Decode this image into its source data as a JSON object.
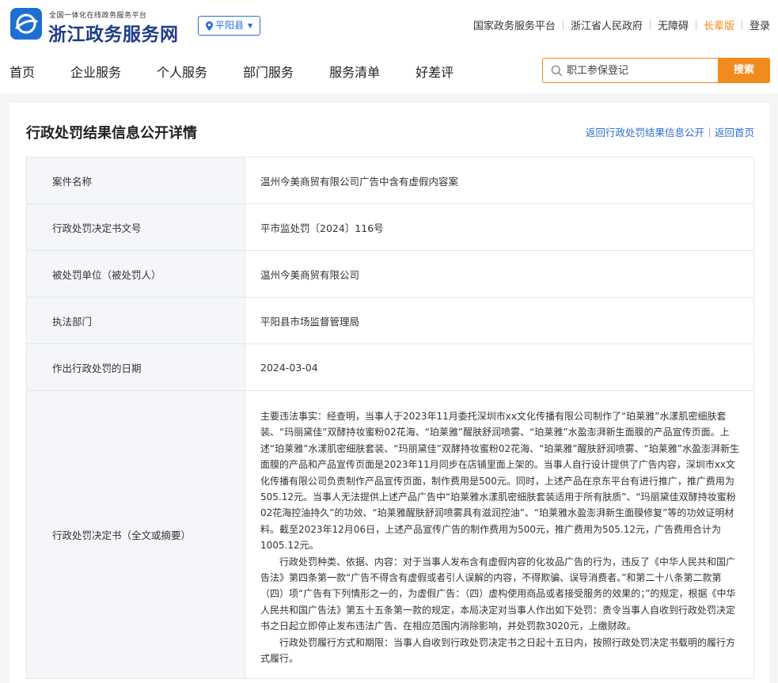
{
  "header": {
    "logo_subtitle": "全国一体化在线政务服务平台",
    "logo_title": "浙江政务服务网",
    "region": "平阳县",
    "top_links": [
      {
        "label": "国家政务服务平台"
      },
      {
        "label": "浙江省人民政府"
      },
      {
        "label": "无障碍"
      },
      {
        "label": "长辈版"
      },
      {
        "label": "登录"
      }
    ]
  },
  "nav": {
    "items": [
      {
        "label": "首页"
      },
      {
        "label": "企业服务"
      },
      {
        "label": "个人服务"
      },
      {
        "label": "部门服务"
      },
      {
        "label": "服务清单"
      },
      {
        "label": "好差评"
      }
    ]
  },
  "search": {
    "placeholder": "职工参保登记",
    "button": "搜索"
  },
  "page": {
    "title": "行政处罚结果信息公开详情",
    "back_link": "返回行政处罚结果信息公开",
    "home_link": "返回首页"
  },
  "rows": [
    {
      "key": "案件名称",
      "value": "温州今美商贸有限公司广告中含有虚假内容案"
    },
    {
      "key": "行政处罚决定书文号",
      "value": "平市监处罚〔2024〕116号"
    },
    {
      "key": "被处罚单位（被处罚人）",
      "value": "温州今美商贸有限公司"
    },
    {
      "key": "执法部门",
      "value": "平阳县市场监督管理局"
    },
    {
      "key": "作出行政处罚的日期",
      "value": "2024-03-04"
    }
  ],
  "decision": {
    "key": "行政处罚决定书（全文或摘要）",
    "paragraphs": [
      "主要违法事实：经查明，当事人于2023年11月委托深圳市xx文化传播有限公司制作了“珀莱雅”水漾肌密细肤套装、“玛丽黛佳”双酵持妆蜜粉02花海、“珀莱雅”醒肤舒润喷雾、“珀莱雅”水盈澎湃新生面膜的产品宣传页面。上述“珀莱雅”水漾肌密细肤套装、“玛丽黛佳”双酵持妆蜜粉02花海、“珀莱雅”醒肤舒润喷雾、“珀莱雅”水盈澎湃新生面膜的产品和产品宣传页面是2023年11月同步在店铺里面上架的。当事人自行设计提供了广告内容，深圳市xx文化传播有限公司负责制作产品宣传页面，制作费用是500元。同时，上述产品在京东平台有进行推广，推广费用为505.12元。当事人无法提供上述产品广告中“珀莱雅水漾肌密细肤套装适用于所有肤质”、“玛丽黛佳双酵持妆蜜粉02花海控油持久”的功效、“珀莱雅醒肤舒润喷雾具有滋润控油”、“珀莱雅水盈澎湃新生面膜修复”等的功效证明材料。截至2023年12月06日，上述产品宣传广告的制作费用为500元，推广费用为505.12元，广告费用合计为1005.12元。",
      "行政处罚种类、依据、内容：对于当事人发布含有虚假内容的化妆品广告的行为，违反了《中华人民共和国广告法》第四条第一款“广告不得含有虚假或者引人误解的内容，不得欺骗、误导消费者。”和第二十八条第二款第（四）项“广告有下列情形之一的，为虚假广告：（四）虚构使用商品或者接受服务的效果的；”的规定，根据《中华人民共和国广告法》第五十五条第一款的规定，本局决定对当事人作出如下处罚：责令当事人自收到行政处罚决定书之日起立即停止发布违法广告、在相应范围内消除影响，并处罚款3020元，上缴财政。",
      "行政处罚履行方式和期限：当事人自收到行政处罚决定书之日起十五日内，按照行政处罚决定书载明的履行方式履行。"
    ]
  },
  "colors": {
    "brand_blue": "#1f3c88",
    "link_blue": "#2a6fd6",
    "accent_orange": "#f28b1d",
    "key_cell_bg": "#f4f6f9"
  }
}
